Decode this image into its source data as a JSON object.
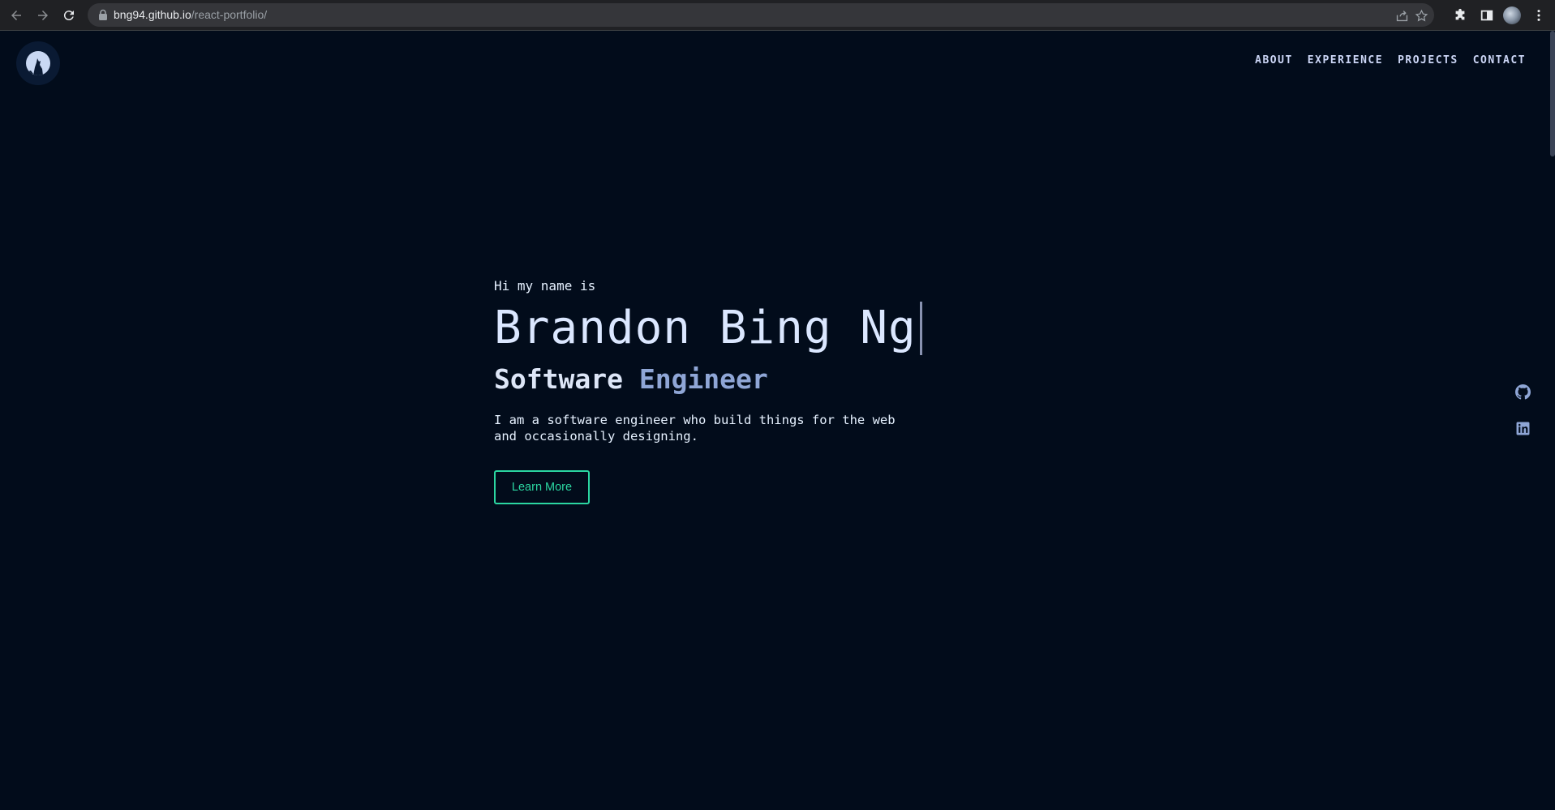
{
  "browser": {
    "url_host": "bng94.github.io",
    "url_path": "/react-portfolio/"
  },
  "nav": {
    "items": [
      "ABOUT",
      "EXPERIENCE",
      "PROJECTS",
      "CONTACT"
    ]
  },
  "hero": {
    "greeting": "Hi my name is",
    "name": "Brandon Bing Ng",
    "title_first": "Software",
    "title_second": "Engineer",
    "description": "I am a software engineer who build things for the web and occasionally designing.",
    "cta_label": "Learn More"
  },
  "colors": {
    "background": "#020c1b",
    "accent": "#2bd6a1",
    "text": "#e6f1ff",
    "muted_blue": "#8fa6d6"
  },
  "icons": {
    "social": [
      "github-icon",
      "linkedin-icon"
    ]
  }
}
